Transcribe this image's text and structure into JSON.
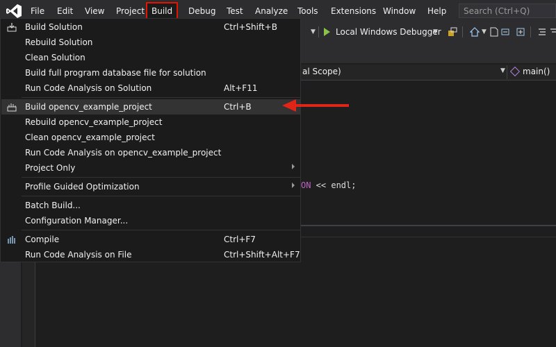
{
  "menubar": {
    "items": [
      "File",
      "Edit",
      "View",
      "Project",
      "Build",
      "Debug",
      "Test",
      "Analyze",
      "Tools",
      "Extensions",
      "Window",
      "Help"
    ],
    "active": "Build",
    "search_placeholder": "Search (Ctrl+Q)"
  },
  "toolbar": {
    "debugger_label": "Local Windows Debugger"
  },
  "editor": {
    "scope_label": "al Scope)",
    "function_label": "main()",
    "code_macro": "ON",
    "code_rest": " << endl;"
  },
  "build_menu": {
    "items": [
      {
        "label": "Build Solution",
        "shortcut": "Ctrl+Shift+B",
        "icon": "build-solution-icon"
      },
      {
        "label": "Rebuild Solution",
        "shortcut": ""
      },
      {
        "label": "Clean Solution",
        "shortcut": ""
      },
      {
        "label": "Build full program database file for solution",
        "shortcut": ""
      },
      {
        "label": "Run Code Analysis on Solution",
        "shortcut": "Alt+F11"
      },
      {
        "label": "Build opencv_example_project",
        "shortcut": "Ctrl+B",
        "icon": "build-project-icon",
        "highlighted": true
      },
      {
        "label": "Rebuild opencv_example_project",
        "shortcut": ""
      },
      {
        "label": "Clean opencv_example_project",
        "shortcut": ""
      },
      {
        "label": "Run Code Analysis on opencv_example_project",
        "shortcut": ""
      },
      {
        "label": "Project Only",
        "shortcut": "",
        "submenu": true
      },
      {
        "label": "Profile Guided Optimization",
        "shortcut": "",
        "submenu": true
      },
      {
        "label": "Batch Build...",
        "shortcut": ""
      },
      {
        "label": "Configuration Manager...",
        "shortcut": ""
      },
      {
        "label": "Compile",
        "shortcut": "Ctrl+F7",
        "icon": "compile-icon"
      },
      {
        "label": "Run Code Analysis on File",
        "shortcut": "Ctrl+Shift+Alt+F7"
      }
    ]
  },
  "colors": {
    "accent_red": "#e51400",
    "arrow_red": "#e02418",
    "menu_bg": "#1b1b1c",
    "chrome_bg": "#2d2d30"
  }
}
